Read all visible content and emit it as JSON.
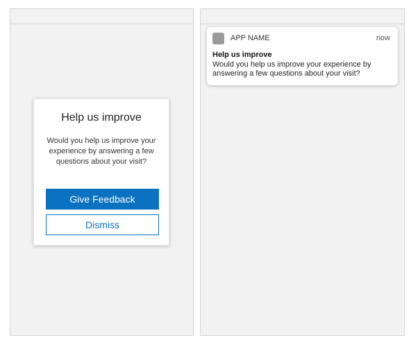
{
  "dialog": {
    "title": "Help us improve",
    "body": "Would you help us improve your experience by answering a few questions about your visit?",
    "primary_button": "Give Feedback",
    "secondary_button": "Dismiss"
  },
  "notification": {
    "app_icon": "app-icon",
    "app_name": "APP NAME",
    "time": "now",
    "title": "Help us improve",
    "body": "Would you help us improve your experience by answering a few questions about your visit?"
  },
  "colors": {
    "accent": "#0a72c1",
    "screen_background": "#f2f2f2",
    "card_background": "#ffffff"
  }
}
